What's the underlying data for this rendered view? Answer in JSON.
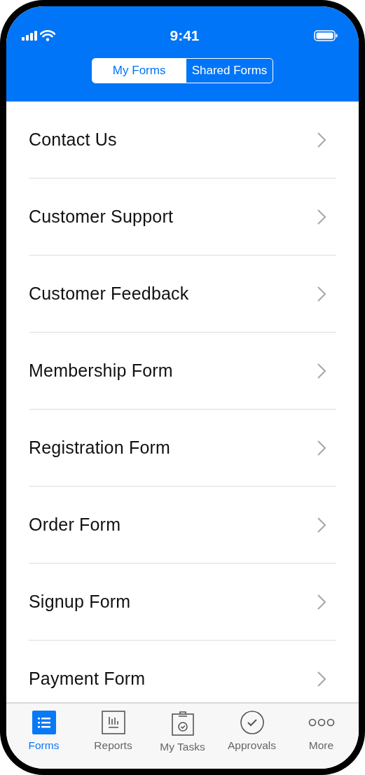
{
  "status_bar": {
    "time": "9:41"
  },
  "segments": [
    {
      "label": "My Forms",
      "selected": true
    },
    {
      "label": "Shared Forms",
      "selected": false
    }
  ],
  "forms": [
    {
      "title": "Contact Us"
    },
    {
      "title": "Customer Support"
    },
    {
      "title": "Customer Feedback"
    },
    {
      "title": "Membership Form"
    },
    {
      "title": "Registration Form"
    },
    {
      "title": "Order Form"
    },
    {
      "title": "Signup Form"
    },
    {
      "title": "Payment Form"
    }
  ],
  "tab_bar": [
    {
      "label": "Forms",
      "kind": "forms",
      "selected": true
    },
    {
      "label": "Reports",
      "kind": "reports",
      "selected": false
    },
    {
      "label": "My Tasks",
      "kind": "tasks",
      "selected": false
    },
    {
      "label": "Approvals",
      "kind": "approvals",
      "selected": false
    },
    {
      "label": "More",
      "kind": "more",
      "selected": false
    }
  ]
}
